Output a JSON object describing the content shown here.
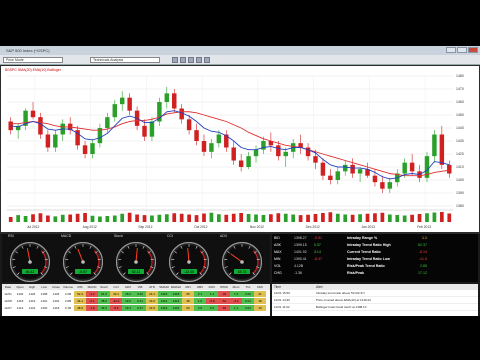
{
  "app": {
    "title": "S&P 500 Index (^GSPC)"
  },
  "toolbar": {
    "symbol": "Price Mode",
    "field2": "Technicals Analysis"
  },
  "chart_data": {
    "type": "line",
    "legend_text": "$GSPC  SMA(20)  EMA(10)  Bollinger",
    "x_labels": [
      "Jul 2012",
      "Aug 2012",
      "Sep 2012",
      "Oct 2012",
      "Nov 2012",
      "Dec 2012",
      "Jan 2013",
      "Feb 2013"
    ],
    "y_labels": [
      "1480",
      "1470",
      "1460",
      "1450",
      "1440",
      "1430",
      "1420",
      "1410",
      "1400",
      "1390",
      "1380"
    ],
    "ylim": [
      1370,
      1490
    ],
    "candles": [
      [
        1448,
        1452,
        1436,
        1440
      ],
      [
        1440,
        1446,
        1432,
        1444
      ],
      [
        1444,
        1460,
        1440,
        1458
      ],
      [
        1458,
        1466,
        1450,
        1452
      ],
      [
        1452,
        1456,
        1432,
        1436
      ],
      [
        1436,
        1440,
        1420,
        1424
      ],
      [
        1424,
        1440,
        1420,
        1436
      ],
      [
        1436,
        1450,
        1430,
        1446
      ],
      [
        1446,
        1452,
        1436,
        1440
      ],
      [
        1440,
        1444,
        1422,
        1426
      ],
      [
        1426,
        1430,
        1414,
        1418
      ],
      [
        1418,
        1432,
        1414,
        1428
      ],
      [
        1428,
        1446,
        1424,
        1442
      ],
      [
        1442,
        1456,
        1438,
        1452
      ],
      [
        1452,
        1468,
        1448,
        1464
      ],
      [
        1464,
        1476,
        1458,
        1470
      ],
      [
        1470,
        1474,
        1454,
        1458
      ],
      [
        1458,
        1462,
        1440,
        1444
      ],
      [
        1444,
        1450,
        1430,
        1434
      ],
      [
        1434,
        1452,
        1430,
        1448
      ],
      [
        1448,
        1470,
        1444,
        1466
      ],
      [
        1466,
        1480,
        1460,
        1474
      ],
      [
        1474,
        1478,
        1456,
        1460
      ],
      [
        1460,
        1464,
        1446,
        1450
      ],
      [
        1450,
        1454,
        1436,
        1440
      ],
      [
        1440,
        1446,
        1426,
        1430
      ],
      [
        1430,
        1436,
        1416,
        1420
      ],
      [
        1420,
        1432,
        1414,
        1428
      ],
      [
        1428,
        1440,
        1424,
        1436
      ],
      [
        1436,
        1440,
        1420,
        1424
      ],
      [
        1424,
        1430,
        1408,
        1412
      ],
      [
        1412,
        1418,
        1402,
        1406
      ],
      [
        1406,
        1420,
        1404,
        1416
      ],
      [
        1416,
        1426,
        1410,
        1422
      ],
      [
        1422,
        1434,
        1418,
        1430
      ],
      [
        1430,
        1438,
        1420,
        1426
      ],
      [
        1426,
        1430,
        1412,
        1416
      ],
      [
        1416,
        1424,
        1406,
        1420
      ],
      [
        1420,
        1432,
        1414,
        1428
      ],
      [
        1428,
        1436,
        1418,
        1424
      ],
      [
        1424,
        1428,
        1412,
        1416
      ],
      [
        1416,
        1422,
        1404,
        1410
      ],
      [
        1410,
        1414,
        1394,
        1398
      ],
      [
        1398,
        1404,
        1390,
        1394
      ],
      [
        1394,
        1406,
        1390,
        1402
      ],
      [
        1402,
        1412,
        1398,
        1408
      ],
      [
        1408,
        1414,
        1396,
        1400
      ],
      [
        1400,
        1406,
        1392,
        1404
      ],
      [
        1404,
        1410,
        1396,
        1398
      ],
      [
        1398,
        1404,
        1388,
        1392
      ],
      [
        1392,
        1398,
        1382,
        1386
      ],
      [
        1386,
        1396,
        1382,
        1392
      ],
      [
        1392,
        1404,
        1388,
        1400
      ],
      [
        1400,
        1414,
        1396,
        1410
      ],
      [
        1410,
        1418,
        1398,
        1402
      ],
      [
        1402,
        1408,
        1392,
        1396
      ],
      [
        1396,
        1420,
        1392,
        1416
      ],
      [
        1416,
        1440,
        1410,
        1436
      ],
      [
        1436,
        1444,
        1404,
        1408
      ],
      [
        1408,
        1412,
        1396,
        1400
      ]
    ],
    "series": [
      {
        "color": "#e03030",
        "values": [
          1446,
          1446,
          1447,
          1448,
          1447,
          1446,
          1444,
          1443,
          1443,
          1442,
          1441,
          1440,
          1440,
          1441,
          1443,
          1446,
          1448,
          1449,
          1449,
          1450,
          1452,
          1455,
          1456,
          1457,
          1457,
          1456,
          1454,
          1452,
          1450,
          1448,
          1445,
          1442,
          1438,
          1435,
          1432,
          1430,
          1428,
          1426,
          1425,
          1424,
          1422,
          1420,
          1418,
          1416,
          1414,
          1412,
          1410,
          1408,
          1406,
          1404,
          1402,
          1400,
          1399,
          1398,
          1398,
          1398,
          1399,
          1401,
          1402,
          1403
        ]
      },
      {
        "color": "#2040c0",
        "values": [
          1444,
          1443,
          1446,
          1448,
          1446,
          1441,
          1440,
          1441,
          1441,
          1437,
          1432,
          1431,
          1433,
          1437,
          1444,
          1451,
          1453,
          1451,
          1447,
          1447,
          1451,
          1457,
          1458,
          1456,
          1453,
          1448,
          1442,
          1439,
          1438,
          1435,
          1430,
          1424,
          1422,
          1422,
          1424,
          1425,
          1423,
          1422,
          1424,
          1424,
          1422,
          1419,
          1413,
          1408,
          1406,
          1406,
          1405,
          1405,
          1404,
          1401,
          1397,
          1395,
          1396,
          1399,
          1400,
          1399,
          1403,
          1411,
          1410,
          1408
        ]
      }
    ],
    "volume": [
      40,
      55,
      48,
      62,
      70,
      52,
      45,
      58,
      60,
      66,
      72,
      50,
      44,
      48,
      52,
      66,
      74,
      60,
      55,
      52,
      58,
      62,
      70,
      66,
      60,
      55,
      68,
      74,
      62,
      58,
      66,
      72,
      64,
      60,
      56,
      62,
      70,
      66,
      60,
      55,
      58,
      64,
      72,
      78,
      66,
      60,
      58,
      62,
      66,
      70,
      74,
      60,
      56,
      52,
      58,
      64,
      70,
      76,
      80,
      68
    ]
  },
  "gauges": [
    {
      "title": "RSI",
      "value": "46.42",
      "needle": 0.46
    },
    {
      "title": "MACD",
      "value": "-0.97",
      "needle": 0.42
    },
    {
      "title": "Stoch",
      "value": "52.11",
      "needle": 0.52
    },
    {
      "title": "CCI",
      "value": "-12.40",
      "needle": 0.48
    },
    {
      "title": "ADX",
      "value": "18.73",
      "needle": 0.3
    }
  ],
  "quote": {
    "rows": [
      {
        "label": "BID",
        "c1": "1398.27",
        "c2": "-0.51",
        "c3": "-0.04%"
      },
      {
        "label": "ASK",
        "c1": "1399.15",
        "c2": "0.37",
        "c3": "0.03%"
      },
      {
        "label": "MAX",
        "c1": "1401.92",
        "c2": "3.14",
        "c3": "0.22%"
      },
      {
        "label": "MIN",
        "c1": "1390.41",
        "c2": "-8.37",
        "c3": "-0.60%"
      },
      {
        "label": "VOL",
        "c1": "4.12B",
        "c2": "",
        "c3": ""
      },
      {
        "label": "CHG",
        "c1": "-1.36",
        "c2": "",
        "c3": "-0.10%"
      }
    ],
    "summary": [
      {
        "k": "Intraday Range %",
        "v": "1.1",
        "c": "#ffcc33"
      },
      {
        "k": "Intraday Trend Ratio High",
        "v": "62.37",
        "c": "#33cc33"
      },
      {
        "k": "Current Trend Ratio",
        "v": "-8.14",
        "c": "#ff3333"
      },
      {
        "k": "Intraday Trend Ratio Low",
        "v": "-41.8",
        "c": "#ff3333"
      },
      {
        "k": "Risk/Peak Trend Ratio",
        "v": "2.85",
        "c": "#33cc33"
      },
      {
        "k": "Risk/Peak",
        "v": "17.12",
        "c": "#33cc33"
      }
    ]
  },
  "table": {
    "headers": [
      "Date",
      "Open",
      "High",
      "Low",
      "Close",
      "Volume",
      "RSI",
      "MACD",
      "Stoch",
      "CCI",
      "ADX",
      "%B",
      "ATR",
      "SMA20",
      "EMA10",
      "MFI",
      "OBV",
      "ROC",
      "W%R",
      "Mom",
      "Trix",
      "DMI"
    ],
    "rows": [
      [
        "12/31",
        "1402",
        "1426",
        "1398",
        "1426",
        "3.2B",
        "52.4",
        "-1.2",
        "61.3",
        "40.1",
        "18.2",
        "0.62",
        "14.1",
        "1415",
        "1418",
        "55",
        "2.1",
        "1.4",
        "-34",
        "7.3",
        "0.02",
        "21"
      ],
      [
        "12/28",
        "1418",
        "1419",
        "1401",
        "1402",
        "2.8B",
        "44.1",
        "-2.1",
        "38.2",
        "-22.4",
        "19.0",
        "0.41",
        "14.6",
        "1414",
        "1413",
        "48",
        "1.9",
        "-0.8",
        "-61",
        "-4.2",
        "0.01",
        "18"
      ],
      [
        "12/27",
        "1419",
        "1422",
        "1400",
        "1418",
        "3.1B",
        "48.9",
        "-1.8",
        "44.0",
        "-8.6",
        "19.4",
        "0.47",
        "14.9",
        "1416",
        "1415",
        "50",
        "2.0",
        "0.3",
        "-52",
        "1.1",
        "0.01",
        "19"
      ]
    ]
  },
  "log": {
    "headers": [
      "Time",
      "Alert"
    ],
    "rows": [
      [
        "12/31 15:59",
        "Intraday trend ratio above 50 (62.37)"
      ],
      [
        "12/31 14:30",
        "Price crossed above EMA(10) at 1418.22"
      ],
      [
        "12/31 11:02",
        "Bollinger lower band touch at 1398.10"
      ]
    ]
  }
}
